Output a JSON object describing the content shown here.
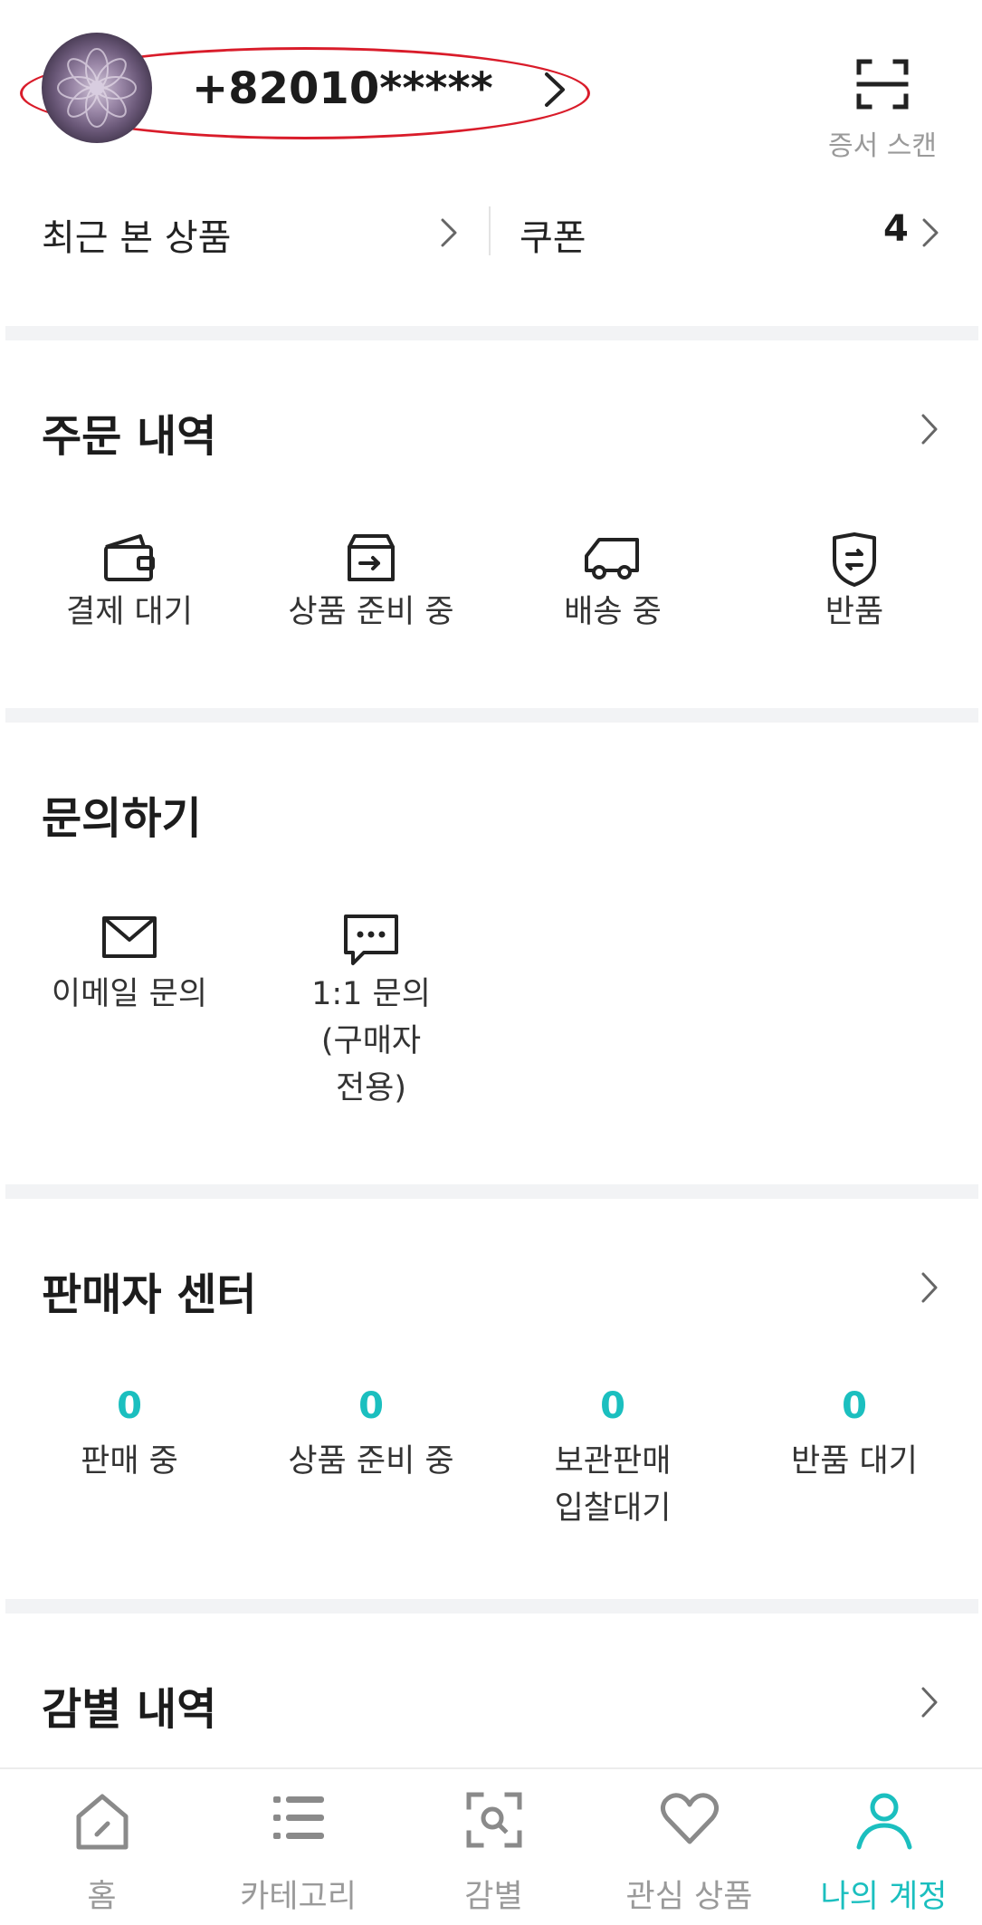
{
  "profile": {
    "phone": "+82010*****"
  },
  "scan": {
    "label": "증서 스캔"
  },
  "quick_links": {
    "recent_label": "최근 본 상품",
    "coupon_label": "쿠폰",
    "coupon_count": "4"
  },
  "orders": {
    "title": "주문 내역",
    "items": [
      {
        "label": "결제 대기",
        "icon": "wallet-icon"
      },
      {
        "label": "상품 준비 중",
        "icon": "box-icon"
      },
      {
        "label": "배송 중",
        "icon": "truck-icon"
      },
      {
        "label": "반품",
        "icon": "return-shield-icon"
      }
    ]
  },
  "inquiry": {
    "title": "문의하기",
    "items": [
      {
        "label": "이메일 문의",
        "icon": "mail-icon"
      },
      {
        "line1": "1:1 문의",
        "line2": "(구매자",
        "line3": "전용)",
        "icon": "chat-icon"
      }
    ]
  },
  "seller": {
    "title": "판매자 센터",
    "items": [
      {
        "count": "0",
        "label": "판매 중"
      },
      {
        "count": "0",
        "label": "상품 준비 중"
      },
      {
        "count": "0",
        "line1": "보관판매",
        "line2": "입찰대기"
      },
      {
        "count": "0",
        "label": "반품 대기"
      }
    ]
  },
  "appraisal": {
    "title": "감별 내역"
  },
  "bottom_nav": {
    "items": [
      {
        "label": "홈",
        "icon": "home-icon"
      },
      {
        "label": "카테고리",
        "icon": "category-list-icon"
      },
      {
        "label": "감별",
        "icon": "appraisal-scan-icon"
      },
      {
        "label": "관심 상품",
        "icon": "heart-icon"
      },
      {
        "label": "나의 계정",
        "icon": "user-icon"
      }
    ],
    "active_index": 4
  },
  "colors": {
    "accent": "#1bbfbf",
    "highlight_outline": "#d91c2a",
    "separator": "#f2f3f5"
  }
}
